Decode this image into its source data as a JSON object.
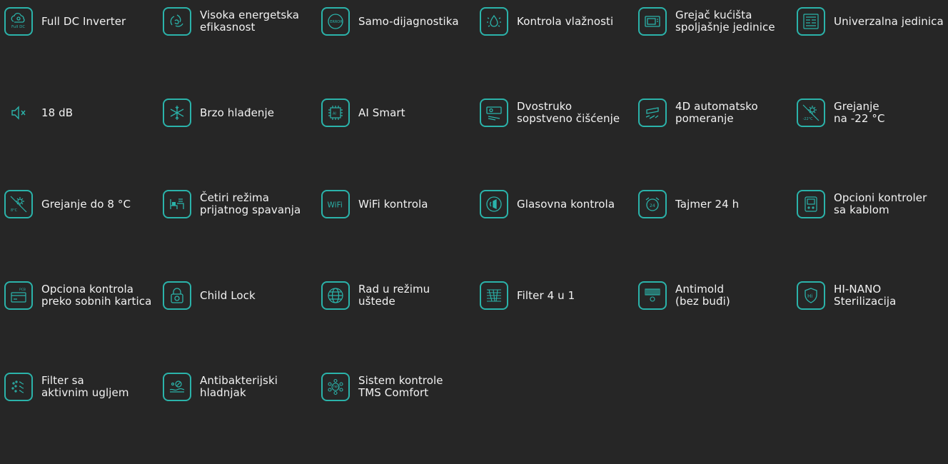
{
  "features": [
    {
      "label": "Full DC Inverter",
      "icon": "cloud-fulldc-icon"
    },
    {
      "label": "Visoka energetska\nefikasnost",
      "icon": "leaf-recycle-icon"
    },
    {
      "label": "Samo-dijagnostika",
      "icon": "error-diagnostic-icon"
    },
    {
      "label": "Kontrola vlažnosti",
      "icon": "humidity-drop-icon"
    },
    {
      "label": "Grejač kućišta\nspoljašnje jedinice",
      "icon": "outdoor-unit-icon"
    },
    {
      "label": "Univerzalna jedinica",
      "icon": "universal-unit-icon"
    },
    {
      "label": "18 dB",
      "icon": "speaker-mute-icon"
    },
    {
      "label": "Brzo hlađenje",
      "icon": "snowflake-icon"
    },
    {
      "label": "AI Smart",
      "icon": "ai-chip-icon"
    },
    {
      "label": "Dvostruko\nsopstveno čišćenje",
      "icon": "self-clean-icon"
    },
    {
      "label": "4D automatsko\npomeranje",
      "icon": "swing-airflow-icon"
    },
    {
      "label": "Grejanje\nna -22 °C",
      "icon": "heating-minus22-icon"
    },
    {
      "label": "Grejanje do 8 °C",
      "icon": "heating-8c-icon"
    },
    {
      "label": "Četiri režima\nprijatnog spavanja",
      "icon": "sleep-mode-icon"
    },
    {
      "label": "WiFi kontrola",
      "icon": "wifi-icon"
    },
    {
      "label": "Glasovna kontrola",
      "icon": "voice-control-icon"
    },
    {
      "label": "Tajmer 24 h",
      "icon": "alarm-clock-icon"
    },
    {
      "label": "Opcioni kontroler\nsa kablom",
      "icon": "wired-controller-icon"
    },
    {
      "label": "Opciona kontrola\npreko sobnih kartica",
      "icon": "room-card-icon"
    },
    {
      "label": "Child Lock",
      "icon": "child-lock-icon"
    },
    {
      "label": "Rad u režimu\nuštede",
      "icon": "globe-eco-icon"
    },
    {
      "label": "Filter 4 u 1",
      "icon": "filter-4in1-icon"
    },
    {
      "label": "Antimold\n(bez buđi)",
      "icon": "antimold-icon"
    },
    {
      "label": "HI-NANO\nSterilizacija",
      "icon": "hi-nano-shield-icon"
    },
    {
      "label": "Filter sa\naktivnim ugljem",
      "icon": "carbon-filter-icon"
    },
    {
      "label": "Antibakterijski\nhladnjak",
      "icon": "antibacterial-icon"
    },
    {
      "label": "Sistem kontrole\nTMS Comfort",
      "icon": "tms-comfort-icon"
    }
  ],
  "colors": {
    "background": "#262626",
    "accent": "#2bb3aa",
    "text": "#f2f2f2"
  },
  "icon_text": {
    "full_dc": "Full DC",
    "error": "ERROR",
    "ai": "AI",
    "wifi": "WiFi",
    "hi": "Hi",
    "tms": "TMS",
    "minus22": "-22°C",
    "eight": "8°C",
    "timer24": "24",
    "pcb": "PCB"
  }
}
